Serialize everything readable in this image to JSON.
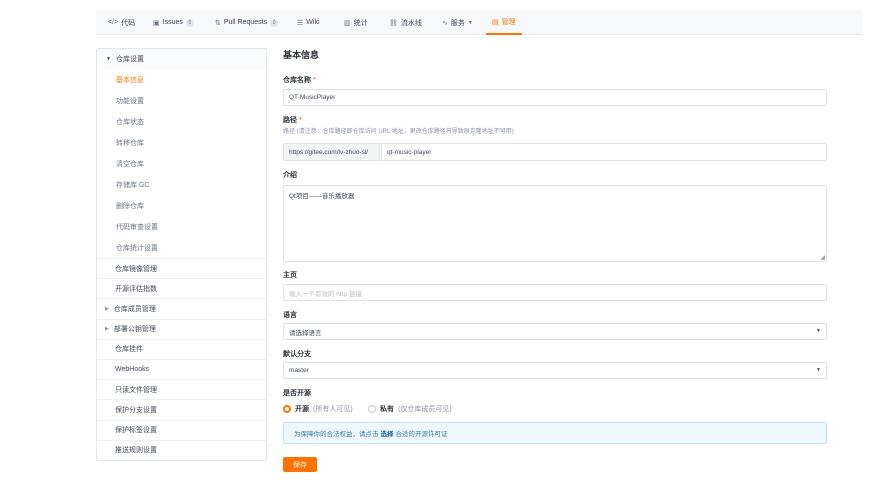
{
  "nav": {
    "tabs": [
      {
        "label": "代码",
        "icon": "code-icon"
      },
      {
        "label": "Issues",
        "icon": "issues-icon",
        "count": "0"
      },
      {
        "label": "Pull Requests",
        "icon": "pull-request-icon",
        "count": "0"
      },
      {
        "label": "Wiki",
        "icon": "wiki-icon"
      },
      {
        "label": "统计",
        "icon": "stats-icon"
      },
      {
        "label": "流水线",
        "icon": "pipeline-icon"
      },
      {
        "label": "服务",
        "icon": "service-icon"
      },
      {
        "label": "管理",
        "icon": "manage-icon"
      }
    ],
    "accent": "#fe7300"
  },
  "sidebar": {
    "group": "仓库设置",
    "subitems": [
      "基本信息",
      "功能设置",
      "仓库状态",
      "转移仓库",
      "清空仓库",
      "存储库 GC",
      "删除仓库",
      "代码审查设置",
      "仓库统计设置"
    ],
    "items": [
      "仓库镜像管理",
      "开源评估指数",
      "仓库成员管理",
      "部署公钥管理",
      "仓库挂件",
      "WebHooks",
      "只读文件管理",
      "保护分支设置",
      "保护标签设置",
      "推送规则设置"
    ]
  },
  "form": {
    "title": "基本信息",
    "name_label": "仓库名称",
    "name_value": "QT-MusicPlayer",
    "path_label": "路径",
    "path_hint": "路径 (请注意：仓库路径即仓库访问 URL 地址，更改仓库路径将导致原克隆地址不可用)",
    "path_prefix": "https://gitee.com/lv-zhuo-si/",
    "path_value": "qt-music-player",
    "intro_label": "介绍",
    "intro_value": "Qt项目——音乐播放器",
    "homepage_label": "主页",
    "homepage_placeholder": "输入一个有效的 http 链接",
    "language_label": "语言",
    "language_value": "请选择语言",
    "branch_label": "默认分支",
    "branch_value": "master",
    "open_label": "是否开源",
    "open_option": "开源",
    "open_note": "(所有人可见)",
    "private_option": "私有",
    "private_note": "(仅仓库成员可见)",
    "notice_prefix": "为保障你的合法权益，请点击",
    "notice_link": "选择",
    "notice_suffix": "合适的开源许可证",
    "save_label": "保存"
  }
}
